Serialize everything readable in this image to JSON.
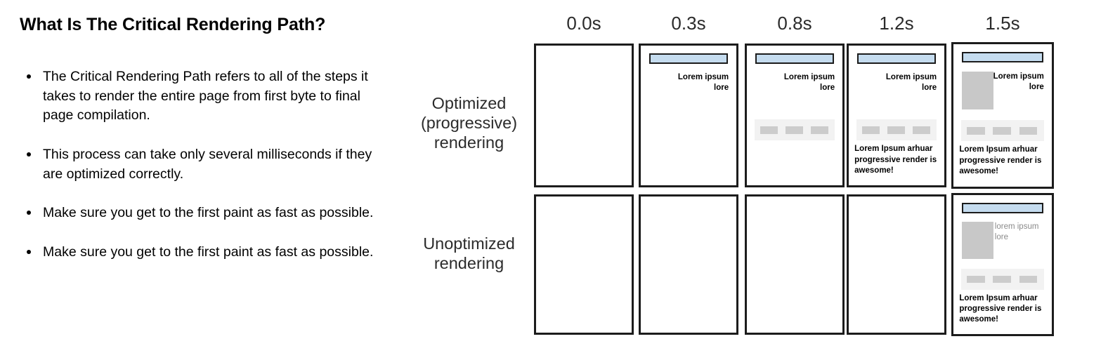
{
  "slide": {
    "title": "What Is The Critical Rendering Path?",
    "bullets": [
      "The Critical Rendering Path refers to all of the steps it takes to render the entire page from first byte to final page compilation.",
      "This process can take only several milliseconds if they are optimized correctly.",
      "Make sure you get to the first paint as fast as possible.",
      "Make sure you get to the first paint as fast as possible."
    ]
  },
  "filmstrip": {
    "time_labels": [
      "0.0s",
      "0.3s",
      "0.8s",
      "1.2s",
      "1.5s"
    ],
    "rows": [
      {
        "label": "Optimized (progressive) rendering",
        "frames": [
          {
            "navbar": false,
            "image": false,
            "heading": "",
            "band": false,
            "paragraph": ""
          },
          {
            "navbar": true,
            "image": false,
            "heading": "Lorem ipsum lore",
            "band": false,
            "paragraph": ""
          },
          {
            "navbar": true,
            "image": false,
            "heading": "Lorem ipsum lore",
            "band": true,
            "paragraph": ""
          },
          {
            "navbar": true,
            "image": false,
            "heading": "Lorem ipsum lore",
            "band": true,
            "paragraph": "Lorem Ipsum arhuar progressive render is awesome!"
          },
          {
            "navbar": true,
            "image": true,
            "heading": "Lorem ipsum lore",
            "band": true,
            "paragraph": "Lorem Ipsum arhuar progressive render is awesome!"
          }
        ]
      },
      {
        "label": "Unoptimized rendering",
        "frames": [
          {
            "navbar": false,
            "image": false,
            "heading": "",
            "band": false,
            "paragraph": ""
          },
          {
            "navbar": false,
            "image": false,
            "heading": "",
            "band": false,
            "paragraph": ""
          },
          {
            "navbar": false,
            "image": false,
            "heading": "",
            "band": false,
            "paragraph": ""
          },
          {
            "navbar": false,
            "image": false,
            "heading": "",
            "band": false,
            "paragraph": ""
          },
          {
            "navbar": true,
            "image": true,
            "heading": "lorem ipsum lore",
            "heading_muted": true,
            "band": true,
            "paragraph": "Lorem Ipsum arhuar progressive render is awesome!"
          }
        ]
      }
    ],
    "colors": {
      "navbar_fill": "#c5dcef",
      "frame_border": "#1c1c1c",
      "band_fill": "#f2f2f2",
      "chip_fill": "#cccccc",
      "image_fill": "#c8c8c8",
      "muted_text": "#8a8a8a"
    }
  }
}
